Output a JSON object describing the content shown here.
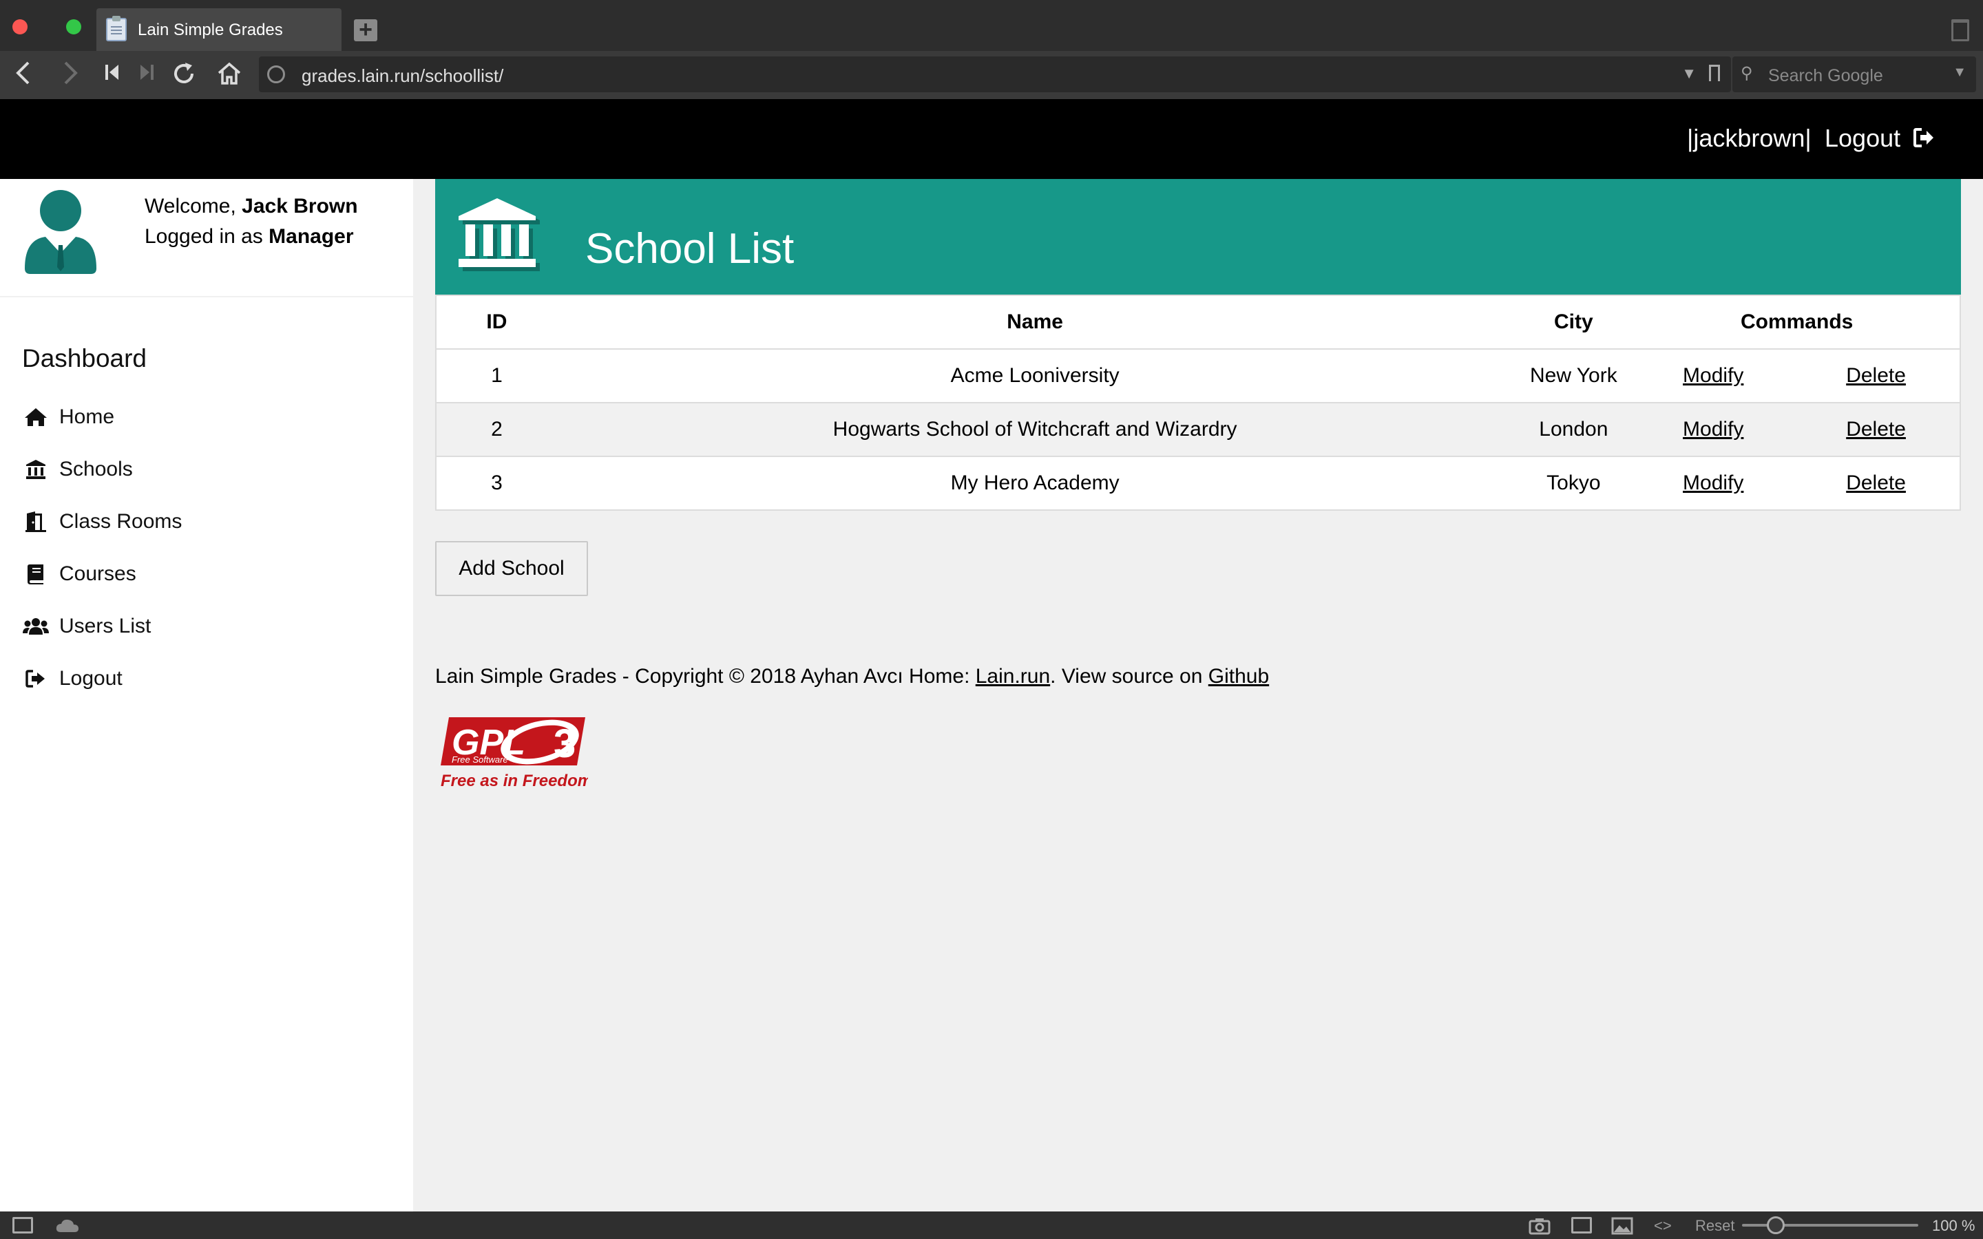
{
  "browser": {
    "tab_title": "Lain Simple Grades",
    "url": "grades.lain.run/schoollist/",
    "search_placeholder": "Search Google"
  },
  "topbar": {
    "username": "|jackbrown|",
    "logout_label": "Logout"
  },
  "sidebar": {
    "welcome_prefix": "Welcome, ",
    "user_name": "Jack Brown",
    "logged_prefix": "Logged in as ",
    "role": "Manager",
    "section_title": "Dashboard",
    "items": [
      {
        "label": "Home",
        "icon": "home-icon"
      },
      {
        "label": "Schools",
        "icon": "bank-icon"
      },
      {
        "label": "Class Rooms",
        "icon": "door-icon"
      },
      {
        "label": "Courses",
        "icon": "book-icon"
      },
      {
        "label": "Users List",
        "icon": "users-icon"
      },
      {
        "label": "Logout",
        "icon": "sign-out-icon"
      }
    ]
  },
  "main": {
    "title": "School List",
    "columns": [
      "ID",
      "Name",
      "City",
      "Commands"
    ],
    "rows": [
      {
        "id": "1",
        "name": "Acme Looniversity",
        "city": "New York",
        "modify": "Modify",
        "delete": "Delete"
      },
      {
        "id": "2",
        "name": "Hogwarts School of Witchcraft and Wizardry",
        "city": "London",
        "modify": "Modify",
        "delete": "Delete"
      },
      {
        "id": "3",
        "name": "My Hero Academy",
        "city": "Tokyo",
        "modify": "Modify",
        "delete": "Delete"
      }
    ],
    "add_button": "Add School"
  },
  "footer": {
    "text_before": "Lain Simple Grades - Copyright © 2018 Ayhan Avcı Home: ",
    "home_link": "Lain.run",
    "text_middle": ". View source on ",
    "github_link": "Github",
    "badge_main": "GPL",
    "badge_version": "3",
    "badge_sub": "Free Software",
    "badge_tagline": "Free as in Freedom"
  },
  "statusbar": {
    "reset_label": "Reset",
    "zoom": "100 %"
  },
  "colors": {
    "accent": "#179889",
    "topbar": "#000000",
    "badge_red": "#c4161c"
  }
}
